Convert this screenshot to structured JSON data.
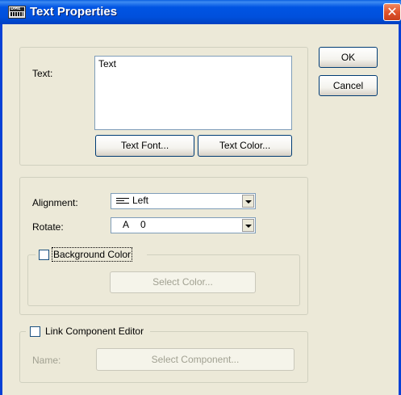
{
  "window": {
    "title": "Text Properties",
    "icon_label": "DME"
  },
  "buttons": {
    "ok": "OK",
    "cancel": "Cancel"
  },
  "text_group": {
    "label": "Text:",
    "value": "Text",
    "font_button": "Text Font...",
    "color_button": "Text Color..."
  },
  "layout_group": {
    "alignment_label": "Alignment:",
    "alignment_value": "Left",
    "rotate_label": "Rotate:",
    "rotate_icon": "A",
    "rotate_value": "0"
  },
  "background_group": {
    "checkbox_label": "Background Color",
    "checked": false,
    "select_button": "Select Color..."
  },
  "component_group": {
    "checkbox_label": "Link Component Editor",
    "checked": false,
    "name_label": "Name:",
    "select_button": "Select Component..."
  },
  "icons": {
    "app": "dme-app-icon",
    "close": "close-icon",
    "alignment": "align-left-icon",
    "dropdown": "chevron-down-icon"
  }
}
